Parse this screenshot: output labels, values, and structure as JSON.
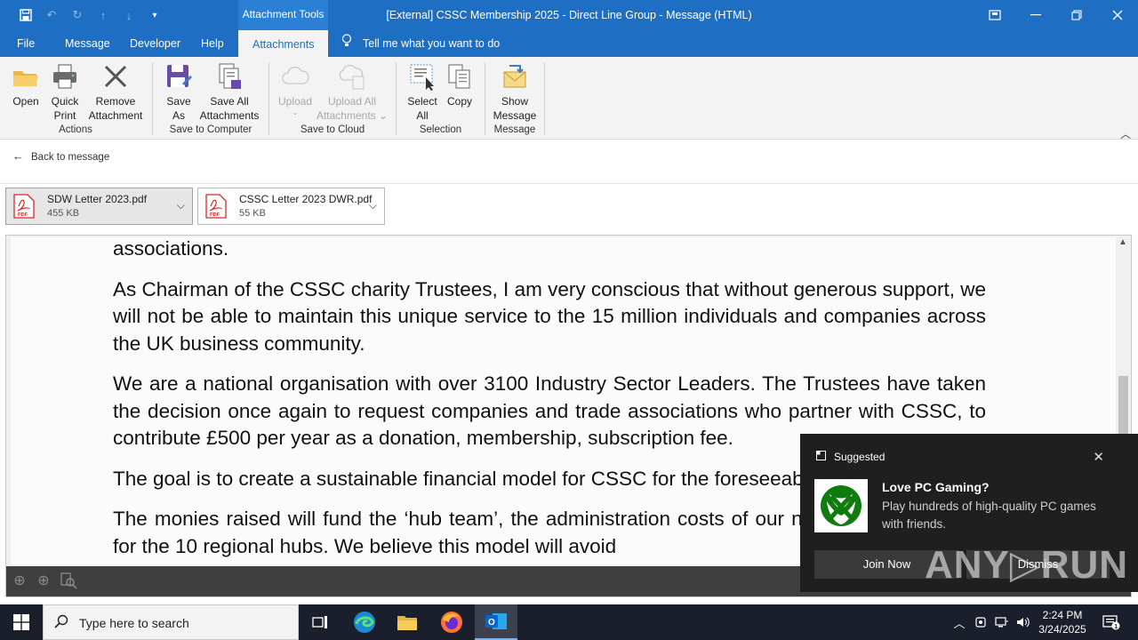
{
  "titlebar": {
    "context_tab": "Attachment Tools",
    "title": "[External] CSSC Membership 2025 - Direct Line Group  -  Message (HTML)"
  },
  "menu": {
    "file": "File",
    "message": "Message",
    "developer": "Developer",
    "help": "Help",
    "attachments": "Attachments",
    "tell_me": "Tell me what you want to do"
  },
  "ribbon": {
    "open": "Open",
    "quick_print_1": "Quick",
    "quick_print_2": "Print",
    "remove_1": "Remove",
    "remove_2": "Attachment",
    "group_actions": "Actions",
    "save_as_1": "Save",
    "save_as_2": "As",
    "save_all_1": "Save All",
    "save_all_2": "Attachments",
    "group_save_computer": "Save to Computer",
    "upload": "Upload",
    "upload_all_1": "Upload All",
    "upload_all_2": "Attachments",
    "group_save_cloud": "Save to Cloud",
    "select_all_1": "Select",
    "select_all_2": "All",
    "copy": "Copy",
    "group_selection": "Selection",
    "show_message_1": "Show",
    "show_message_2": "Message",
    "group_message": "Message"
  },
  "back_link": "Back to message",
  "attachments": [
    {
      "name": "SDW Letter 2023.pdf",
      "size": "455 KB",
      "badge": "PDF"
    },
    {
      "name": "CSSC Letter 2023 DWR.pdf",
      "size": "55 KB",
      "badge": "PDF"
    }
  ],
  "document": {
    "p0": "associations.",
    "p1": "As Chairman of the CSSC charity Trustees, I am very conscious that without generous support, we will not be able to maintain this unique service to the 15 million individuals and companies across the UK business community.",
    "p2": "We are a national organisation with over 3100 Industry Sector Leaders. The Trustees have taken the decision once again to request companies and trade associations who partner with CSSC, to contribute £500 per year as a donation, membership, subscription fee.",
    "p3": "The goal is to create a sustainable financial model for CSSC for the foreseeable future.",
    "p4": "The monies raised will fund the ‘hub team’, the administration costs of our national activities and for the 10 regional hubs. We believe this model will avoid"
  },
  "toast": {
    "header": "Suggested",
    "title": "Love PC Gaming?",
    "body": "Play hundreds of high-quality PC games with friends.",
    "join": "Join Now",
    "dismiss": "Dismiss"
  },
  "watermark": "ANY▷RUN",
  "taskbar": {
    "search_placeholder": "Type here to search",
    "time": "2:24 PM",
    "date": "3/24/2025",
    "notification_count": "1"
  },
  "colors": {
    "titlebar": "#1e6fc4",
    "ribbon": "#f3f3f3",
    "taskbar": "#1a1f2b",
    "pdf_red": "#d42b2b",
    "xbox_green": "#107c10"
  }
}
